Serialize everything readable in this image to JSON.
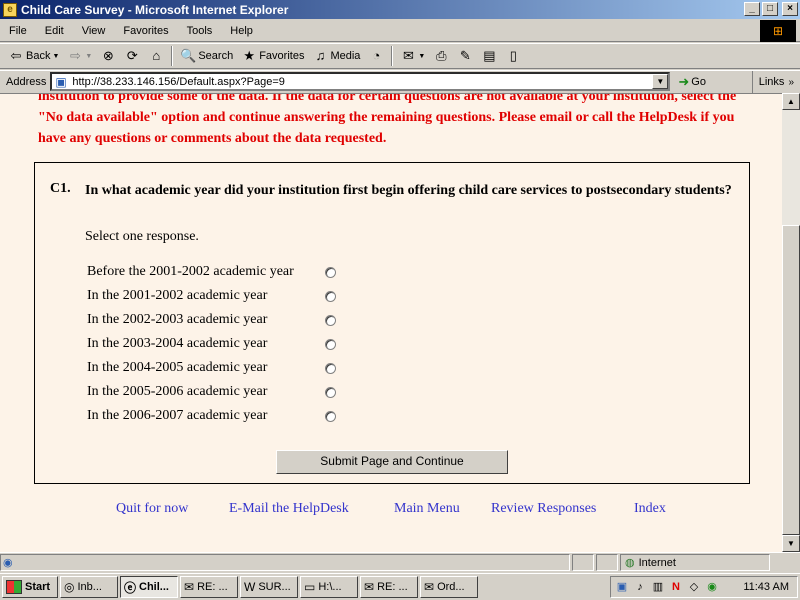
{
  "window": {
    "title": "Child Care Survey - Microsoft Internet Explorer"
  },
  "menu": [
    "File",
    "Edit",
    "View",
    "Favorites",
    "Tools",
    "Help"
  ],
  "toolbar": {
    "back": "Back",
    "search": "Search",
    "favorites": "Favorites",
    "media": "Media"
  },
  "address": {
    "label": "Address",
    "url": "http://38.233.146.156/Default.aspx?Page=9",
    "go": "Go",
    "links": "Links"
  },
  "instructions": "institution to provide some of the data. If the data for certain questions are not available at your institution, select the \"No data available\" option and continue answering the remaining questions. Please email or call the HelpDesk if you have any questions or comments about the data requested.",
  "question": {
    "number": "C1.",
    "text": "In what academic year did your institution first begin offering child care services to postsecondary students?",
    "instruction": "Select one response.",
    "options": [
      "Before the 2001-2002 academic year",
      "In the 2001-2002 academic year",
      "In the 2002-2003 academic year",
      "In the 2003-2004 academic year",
      "In the 2004-2005 academic year",
      "In the 2005-2006 academic year",
      "In the 2006-2007 academic year"
    ],
    "submit_label": "Submit Page and Continue"
  },
  "footer_links": [
    "Quit for now",
    "E-Mail the HelpDesk",
    "Main Menu",
    "Review Responses",
    "Index"
  ],
  "statusbar": {
    "zone": "Internet"
  },
  "taskbar": {
    "start": "Start",
    "buttons": [
      "Inb...",
      "Chil...",
      "RE: ...",
      "SUR...",
      "H:\\...",
      "RE: ...",
      "Ord..."
    ],
    "clock": "11:43 AM"
  },
  "colors": {
    "instruction_text": "#e00000",
    "link": "#3333cc",
    "page_bg": "#fdf3e8"
  }
}
